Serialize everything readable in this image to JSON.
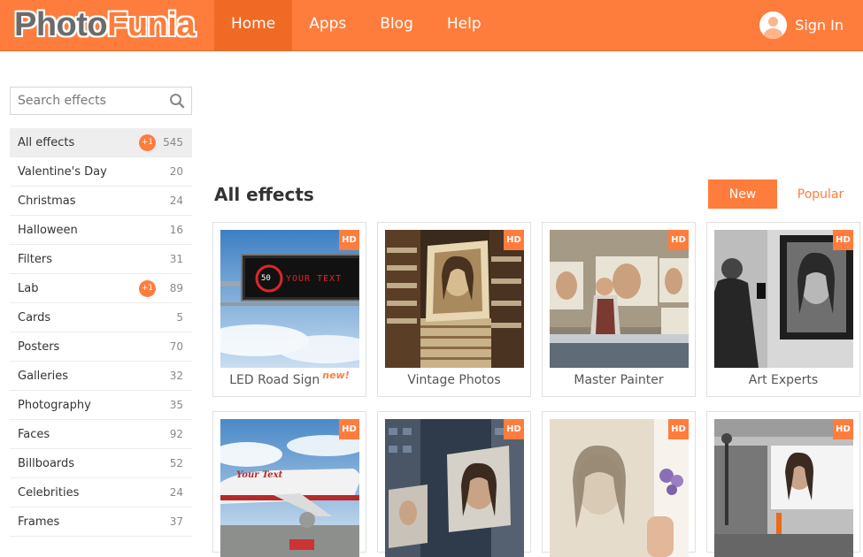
{
  "brand": {
    "part1": "Photo",
    "part2": "Funia"
  },
  "nav": [
    {
      "label": "Home",
      "active": true
    },
    {
      "label": "Apps",
      "active": false
    },
    {
      "label": "Blog",
      "active": false
    },
    {
      "label": "Help",
      "active": false
    }
  ],
  "account": {
    "signin_label": "Sign In"
  },
  "search": {
    "placeholder": "Search effects",
    "value": ""
  },
  "categories": [
    {
      "label": "All effects",
      "count": "545",
      "plus": "+1",
      "active": true
    },
    {
      "label": "Valentine's Day",
      "count": "20"
    },
    {
      "label": "Christmas",
      "count": "24"
    },
    {
      "label": "Halloween",
      "count": "16"
    },
    {
      "label": "Filters",
      "count": "31"
    },
    {
      "label": "Lab",
      "count": "89",
      "plus": "+1"
    },
    {
      "label": "Cards",
      "count": "5"
    },
    {
      "label": "Posters",
      "count": "70"
    },
    {
      "label": "Galleries",
      "count": "32"
    },
    {
      "label": "Photography",
      "count": "35"
    },
    {
      "label": "Faces",
      "count": "92"
    },
    {
      "label": "Billboards",
      "count": "52"
    },
    {
      "label": "Celebrities",
      "count": "24"
    },
    {
      "label": "Frames",
      "count": "37"
    }
  ],
  "main": {
    "title": "All effects",
    "sort_new": "New",
    "sort_popular": "Popular"
  },
  "effects": [
    {
      "label": "LED Road Sign",
      "hd": "HD",
      "new_badge": "new!",
      "sign_speed": "50",
      "sign_text": "YOUR TEXT"
    },
    {
      "label": "Vintage Photos",
      "hd": "HD"
    },
    {
      "label": "Master Painter",
      "hd": "HD"
    },
    {
      "label": "Art Experts",
      "hd": "HD"
    },
    {
      "label": "",
      "hd": "HD",
      "plane_text": "Your Text"
    },
    {
      "label": "",
      "hd": "HD"
    },
    {
      "label": "",
      "hd": "HD"
    },
    {
      "label": "",
      "hd": "HD"
    }
  ],
  "colors": {
    "accent": "#ff7d3c",
    "nav_active": "#f06a25",
    "sidebar_active": "#eeeeee"
  }
}
